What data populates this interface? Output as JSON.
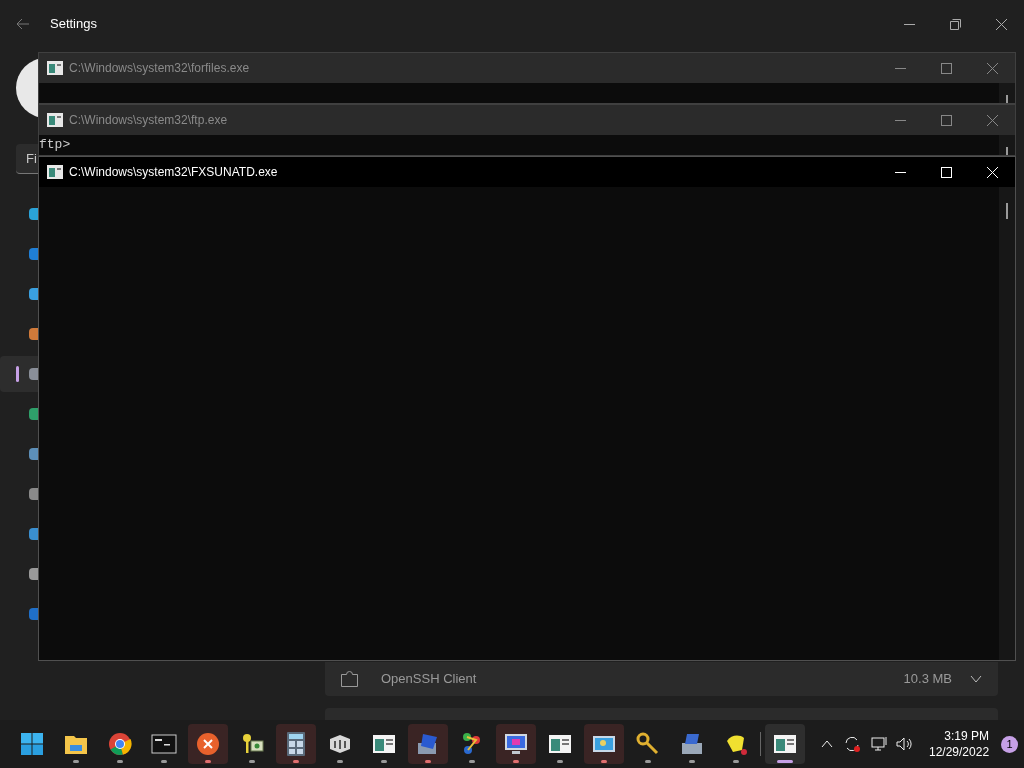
{
  "settings": {
    "title": "Settings",
    "search": {
      "placeholder": "Fi"
    },
    "nav": [
      {
        "kind": "system",
        "selected": false
      },
      {
        "kind": "bluetooth",
        "selected": false
      },
      {
        "kind": "network",
        "selected": false
      },
      {
        "kind": "personalization",
        "selected": false
      },
      {
        "kind": "apps",
        "selected": true
      },
      {
        "kind": "accounts",
        "selected": false
      },
      {
        "kind": "time",
        "selected": false
      },
      {
        "kind": "gaming",
        "selected": false
      },
      {
        "kind": "accessibility",
        "selected": false
      },
      {
        "kind": "privacy",
        "selected": false
      },
      {
        "kind": "update",
        "selected": false
      }
    ],
    "feature": {
      "name": "OpenSSH Client",
      "size": "10.3 MB",
      "expanded": false
    }
  },
  "consoles": [
    {
      "title": "C:\\Windows\\system32\\forfiles.exe",
      "active": false
    },
    {
      "title": "C:\\Windows\\system32\\ftp.exe",
      "active": false,
      "lines": [
        "ftp>"
      ]
    },
    {
      "title": "C:\\Windows\\system32\\FXSUNATD.exe",
      "active": true
    }
  ],
  "taskbar": {
    "apps": [
      {
        "kind": "start",
        "open": false,
        "attention": false,
        "selected": false
      },
      {
        "kind": "folder",
        "open": true,
        "attention": false,
        "selected": false
      },
      {
        "kind": "browser",
        "open": true,
        "attention": false,
        "selected": false
      },
      {
        "kind": "terminal",
        "open": true,
        "attention": false,
        "selected": false
      },
      {
        "kind": "error",
        "open": true,
        "attention": true,
        "selected": false
      },
      {
        "kind": "keys",
        "open": true,
        "attention": false,
        "selected": false
      },
      {
        "kind": "calculator",
        "open": true,
        "attention": true,
        "selected": false
      },
      {
        "kind": "chart",
        "open": true,
        "attention": false,
        "selected": false
      },
      {
        "kind": "console",
        "open": true,
        "attention": false,
        "selected": false
      },
      {
        "kind": "computer",
        "open": true,
        "attention": true,
        "selected": false
      },
      {
        "kind": "network",
        "open": true,
        "attention": false,
        "selected": false
      },
      {
        "kind": "monitor",
        "open": true,
        "attention": true,
        "selected": false
      },
      {
        "kind": "console",
        "open": true,
        "attention": false,
        "selected": false
      },
      {
        "kind": "screen",
        "open": true,
        "attention": true,
        "selected": false
      },
      {
        "kind": "key",
        "open": true,
        "attention": false,
        "selected": false
      },
      {
        "kind": "printer",
        "open": true,
        "attention": false,
        "selected": false
      },
      {
        "kind": "hand",
        "open": true,
        "attention": false,
        "selected": false
      },
      {
        "kind": "console",
        "open": true,
        "attention": false,
        "selected": true
      }
    ],
    "time": "3:19 PM",
    "date": "12/29/2022",
    "notifications": "1"
  }
}
